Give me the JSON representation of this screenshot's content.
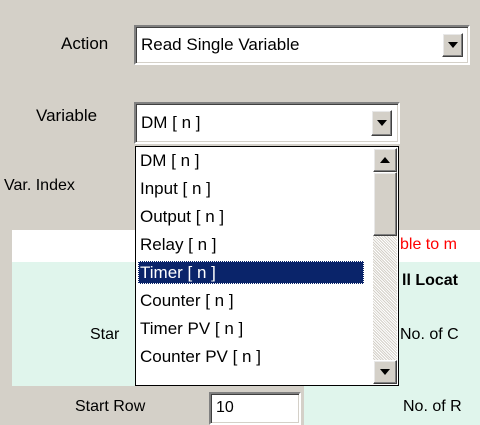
{
  "form": {
    "action_label": "Action",
    "action_value": "Read Single Variable",
    "variable_label": "Variable",
    "variable_value": "DM [ n ]",
    "var_index_label": "Var. Index"
  },
  "dropdown": {
    "options": [
      "DM [ n ]",
      "Input [ n ]",
      "Output [ n ]",
      "Relay [ n ]",
      "Timer [ n ]",
      "Counter [ n ]",
      "Timer PV [ n ]",
      "Counter PV [ n ]"
    ],
    "selected_index": 4
  },
  "panel": {
    "warning_text": "ble to m",
    "header_text": "ll Locat",
    "start_col_label": "Star",
    "no_of_cols_label": "No. of C",
    "start_row_label": "Start Row",
    "start_row_value": "10",
    "no_of_rows_label": "No. of R"
  },
  "colors": {
    "panel_bg": "#e0f5ec",
    "warning": "#ff0000",
    "selection": "#0a246a"
  }
}
